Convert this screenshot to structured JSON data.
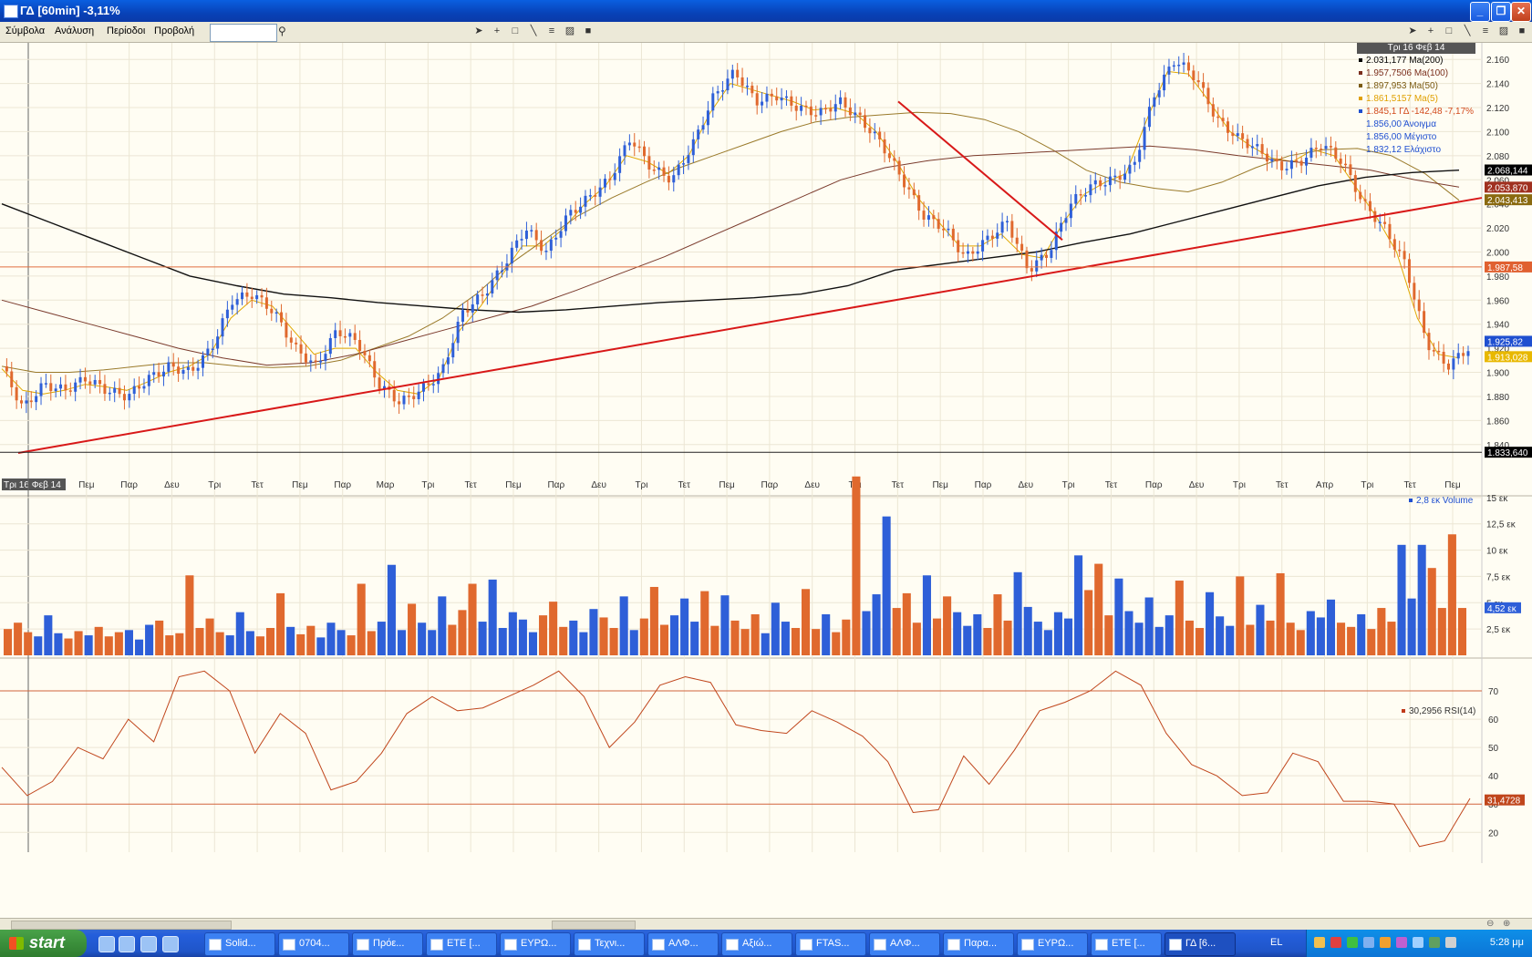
{
  "window": {
    "title": "ΓΔ [60min] -3,11%"
  },
  "menu": [
    "Σύμβολα",
    "Ανάλυση",
    "Περίοδοι",
    "Προβολή"
  ],
  "search": {
    "value": "",
    "placeholder": ""
  },
  "toolbar_icons": [
    "pointer-icon",
    "crosshair-icon",
    "rectangle-icon",
    "line-icon",
    "bars-icon",
    "chart-icon",
    "save-icon"
  ],
  "price_panel": {
    "header_date": "Τρι 16 Φεβ 14",
    "legend": [
      {
        "text": "2.031,177 Ma(200)",
        "color": "#000000"
      },
      {
        "text": "1.957,7506 Ma(100)",
        "color": "#7a2e1c"
      },
      {
        "text": "1.897,953 Ma(50)",
        "color": "#7a5a12"
      },
      {
        "text": "1.861,5157 Ma(5)",
        "color": "#e0a000"
      },
      {
        "text": "1.845,1 ΓΔ -142,48 -7,17%",
        "color": "#d24a1c",
        "secondary": "#1f4fd0"
      },
      {
        "text": "1.856,00 Άνοιγμα",
        "color": "#1f4fd0"
      },
      {
        "text": "1.856,00 Μέγιστο",
        "color": "#1f4fd0"
      },
      {
        "text": "1.832,12 Ελάχιστο",
        "color": "#1f4fd0"
      }
    ],
    "y_ticks": [
      "2.160",
      "2.140",
      "2.120",
      "2.100",
      "2.080",
      "2.060",
      "2.040",
      "2.020",
      "2.000",
      "1.980",
      "1.960",
      "1.940",
      "1.920",
      "1.900",
      "1.880",
      "1.860",
      "1.840"
    ],
    "price_tags": [
      {
        "text": "2.068,144",
        "color": "#000000"
      },
      {
        "text": "2.053,870",
        "color": "#a03020"
      },
      {
        "text": "2.043,413",
        "color": "#8a6a10"
      },
      {
        "text": "1.987,58",
        "color": "#e06030"
      },
      {
        "text": "1.925,82",
        "color": "#1f4fd0"
      },
      {
        "text": "1.913,028",
        "color": "#e8b800"
      },
      {
        "text": "1.833,640",
        "color": "#000000"
      }
    ],
    "x_labels": [
      "Τρι 16 Φεβ 14",
      "Πεμ",
      "Παρ",
      "Δευ",
      "Τρι",
      "Τετ",
      "Πεμ",
      "Παρ",
      "Μαρ",
      "Τρι",
      "Τετ",
      "Πεμ",
      "Παρ",
      "Δευ",
      "Τρι",
      "Τετ",
      "Πεμ",
      "Παρ",
      "Δευ",
      "Τρι",
      "Τετ",
      "Πεμ",
      "Παρ",
      "Δευ",
      "Τρι",
      "Τετ",
      "Παρ",
      "Δευ",
      "Τρι",
      "Τετ",
      "Απρ",
      "Τρι",
      "Τετ",
      "Πεμ"
    ]
  },
  "volume_panel": {
    "legend": "2,8 εκ Volume",
    "y_ticks": [
      "15 εκ",
      "12,5 εκ",
      "10 εκ",
      "7,5 εκ",
      "5 εκ",
      "2,5 εκ"
    ],
    "tag": "4,52 εκ"
  },
  "rsi_panel": {
    "legend": "30,2956 RSI(14)",
    "y_ticks": [
      "70",
      "60",
      "50",
      "40",
      "30",
      "20"
    ],
    "tag": "31,4728"
  },
  "chart_data": [
    {
      "type": "line",
      "title": "ΓΔ [60min]",
      "series": [
        {
          "name": "ΓΔ",
          "values": [
            1905,
            1870,
            1890,
            1885,
            1895,
            1885,
            1880,
            1895,
            1905,
            1900,
            1920,
            1960,
            1965,
            1950,
            1920,
            1905,
            1935,
            1925,
            1890,
            1875,
            1885,
            1900,
            1950,
            1965,
            1990,
            2020,
            2000,
            2030,
            2045,
            2060,
            2095,
            2070,
            2060,
            2090,
            2130,
            2150,
            2125,
            2130,
            2120,
            2115,
            2125,
            2110,
            2090,
            2060,
            2030,
            2020,
            1995,
            2010,
            2025,
            1985,
            2000,
            2040,
            2055,
            2060,
            2070,
            2130,
            2160,
            2145,
            2110,
            2095,
            2085,
            2070,
            2075,
            2090,
            2075,
            2040,
            2020,
            1990,
            1925,
            1905,
            1920
          ]
        },
        {
          "name": "Ma(5)",
          "values": [
            1903,
            1885,
            1882,
            1885,
            1890,
            1888,
            1885,
            1892,
            1900,
            1905,
            1915,
            1945,
            1960,
            1955,
            1935,
            1915,
            1920,
            1920,
            1900,
            1885,
            1882,
            1895,
            1935,
            1955,
            1980,
            2005,
            2005,
            2020,
            2040,
            2055,
            2080,
            2075,
            2065,
            2080,
            2115,
            2140,
            2135,
            2130,
            2125,
            2118,
            2120,
            2115,
            2100,
            2075,
            2045,
            2025,
            2005,
            2005,
            2015,
            1998,
            1995,
            2025,
            2048,
            2058,
            2065,
            2110,
            2150,
            2148,
            2125,
            2100,
            2088,
            2078,
            2075,
            2085,
            2080,
            2055,
            2030,
            2000,
            1945,
            1915,
            1912
          ]
        },
        {
          "name": "Ma(50)",
          "values": [
            1905,
            1900,
            1900,
            1902,
            1905,
            1908,
            1908,
            1905,
            1904,
            1905,
            1910,
            1920,
            1930,
            1945,
            1965,
            1990,
            2010,
            2030,
            2045,
            2058,
            2070,
            2080,
            2090,
            2100,
            2108,
            2112,
            2114,
            2116,
            2115,
            2110,
            2100,
            2085,
            2068,
            2058,
            2053,
            2050,
            2058,
            2070,
            2080,
            2085,
            2086,
            2080,
            2065,
            2043
          ]
        },
        {
          "name": "Ma(100)",
          "values": [
            1960,
            1950,
            1940,
            1930,
            1920,
            1912,
            1906,
            1908,
            1915,
            1925,
            1935,
            1945,
            1955,
            1968,
            1982,
            1996,
            2012,
            2028,
            2044,
            2060,
            2070,
            2076,
            2080,
            2082,
            2084,
            2086,
            2088,
            2085,
            2080,
            2076,
            2072,
            2068,
            2060,
            2054
          ]
        },
        {
          "name": "Ma(200)",
          "values": [
            2040,
            2025,
            2010,
            1995,
            1980,
            1972,
            1965,
            1962,
            1958,
            1955,
            1952,
            1950,
            1952,
            1955,
            1958,
            1960,
            1962,
            1965,
            1972,
            1985,
            1990,
            1995,
            2000,
            2008,
            2015,
            2025,
            2035,
            2045,
            2055,
            2062,
            2066,
            2068
          ]
        }
      ],
      "ylim": [
        1833,
        2170
      ]
    },
    {
      "type": "bar",
      "title": "Volume",
      "series": [
        {
          "name": "Volume",
          "values": [
            2.5,
            3.1,
            2.2,
            1.8,
            3.8,
            2.1,
            1.6,
            2.3,
            1.9,
            2.7,
            1.8,
            2.2,
            2.4,
            1.5,
            2.9,
            3.3,
            1.9,
            2.1,
            7.6,
            2.6,
            3.5,
            2.2,
            1.9,
            4.1,
            2.3,
            1.8,
            2.6,
            5.9,
            2.7,
            2.0,
            2.8,
            1.7,
            3.1,
            2.4,
            1.9,
            6.8,
            2.3,
            3.2,
            8.6,
            2.4,
            4.9,
            3.1,
            2.4,
            5.6,
            2.9,
            4.3,
            6.8,
            3.2,
            7.2,
            2.6,
            4.1,
            3.4,
            2.2,
            3.8,
            5.1,
            2.7,
            3.3,
            2.2,
            4.4,
            3.6,
            2.6,
            5.6,
            2.4,
            3.5,
            6.5,
            2.9,
            3.8,
            5.4,
            3.2,
            6.1,
            2.8,
            5.7,
            3.3,
            2.5,
            3.9,
            2.1,
            5.0,
            3.2,
            2.6,
            6.3,
            2.5,
            3.9,
            2.2,
            3.4,
            17.0,
            4.2,
            5.8,
            13.2,
            4.5,
            5.9,
            3.1,
            7.6,
            3.5,
            5.6,
            4.1,
            2.8,
            3.9,
            2.6,
            5.8,
            3.3,
            7.9,
            4.6,
            3.2,
            2.4,
            4.1,
            3.5,
            9.5,
            6.2,
            8.7,
            3.8,
            7.3,
            4.2,
            3.1,
            5.5,
            2.7,
            3.8,
            7.1,
            3.3,
            2.6,
            6.0,
            3.7,
            2.8,
            7.5,
            2.9,
            4.8,
            3.3,
            7.8,
            3.1,
            2.4,
            4.2,
            3.6,
            5.3,
            3.1,
            2.7,
            3.9,
            2.5,
            4.5,
            3.2,
            10.5,
            5.4,
            10.5,
            8.3,
            4.5,
            11.5,
            4.5
          ]
        }
      ],
      "ylim": [
        0,
        17.5
      ]
    },
    {
      "type": "line",
      "title": "RSI(14)",
      "series": [
        {
          "name": "RSI(14)",
          "values": [
            43,
            33,
            38,
            50,
            46,
            60,
            52,
            75,
            77,
            70,
            48,
            62,
            55,
            35,
            38,
            48,
            62,
            68,
            63,
            64,
            68,
            72,
            77,
            68,
            50,
            59,
            72,
            75,
            73,
            58,
            56,
            55,
            63,
            59,
            54,
            45,
            27,
            28,
            47,
            37,
            49,
            63,
            66,
            70,
            77,
            72,
            55,
            44,
            40,
            33,
            34,
            48,
            45,
            31,
            31,
            30,
            15,
            17,
            32
          ]
        }
      ],
      "ylim": [
        13,
        80
      ]
    }
  ]
}
